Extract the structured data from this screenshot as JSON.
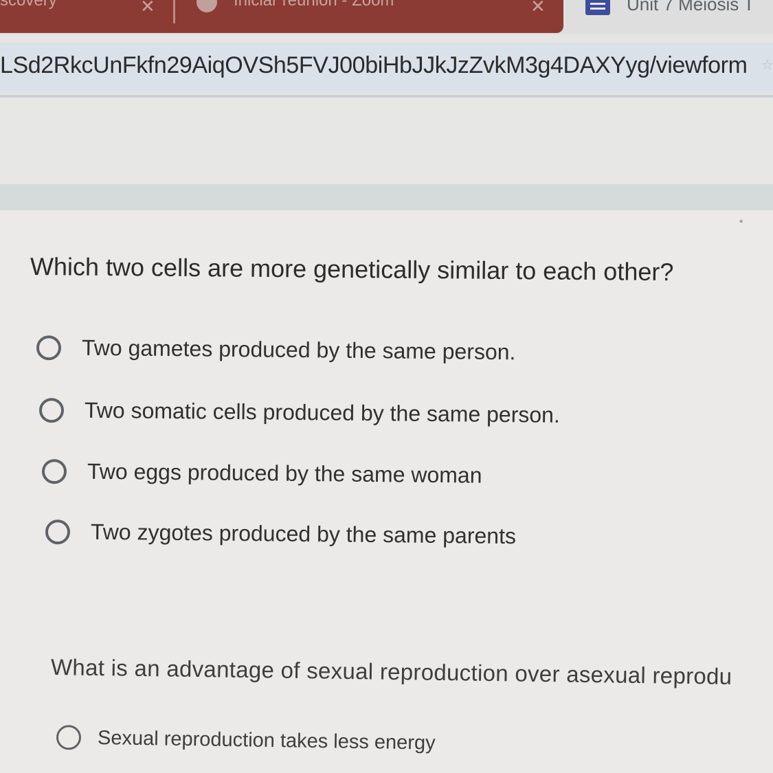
{
  "browser": {
    "tabs": [
      {
        "title": "scovery",
        "close_glyph": "✕"
      },
      {
        "title": "Iniciar reunión - Zoom",
        "icon": "zoom-icon",
        "close_glyph": "✕"
      },
      {
        "title": "Unit 7 Meiosis T",
        "icon": "google-forms-icon"
      }
    ],
    "url": "LSd2RkcUnFkfn29AiqOVSh5FVJ00biHbJJkJzZvkM3g4DAXYyg/viewform",
    "accent_active_tab": "#8b3b33"
  },
  "form": {
    "required_mark": "*",
    "question1": {
      "text": "Which two cells are more genetically similar to each other?",
      "options": [
        "Two gametes produced by the same person.",
        "Two somatic cells produced by the same person.",
        "Two eggs produced by the same woman",
        "Two zygotes produced by the same parents"
      ]
    },
    "question2": {
      "text": "What is an advantage of sexual reproduction over asexual reprodu",
      "options": [
        "Sexual reproduction takes less energy"
      ]
    }
  }
}
